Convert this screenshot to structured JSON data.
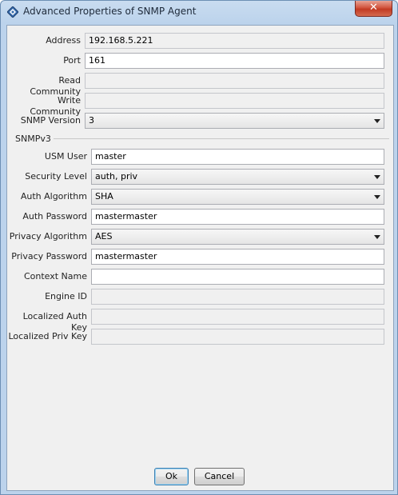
{
  "window": {
    "title": "Advanced Properties of SNMP Agent",
    "close_glyph": "✕"
  },
  "fields": {
    "address": {
      "label": "Address",
      "value": "192.168.5.221"
    },
    "port": {
      "label": "Port",
      "value": "161"
    },
    "read_community": {
      "label": "Read Community",
      "value": ""
    },
    "write_community": {
      "label": "Write Community",
      "value": ""
    },
    "snmp_version": {
      "label": "SNMP Version",
      "value": "3"
    }
  },
  "snmpv3": {
    "section_label": "SNMPv3",
    "usm_user": {
      "label": "USM User",
      "value": "master"
    },
    "security_level": {
      "label": "Security Level",
      "value": "auth, priv"
    },
    "auth_algorithm": {
      "label": "Auth Algorithm",
      "value": "SHA"
    },
    "auth_password": {
      "label": "Auth Password",
      "value": "mastermaster"
    },
    "privacy_algorithm": {
      "label": "Privacy Algorithm",
      "value": "AES"
    },
    "privacy_password": {
      "label": "Privacy Password",
      "value": "mastermaster"
    },
    "context_name": {
      "label": "Context Name",
      "value": ""
    },
    "engine_id": {
      "label": "Engine ID",
      "value": ""
    },
    "localized_auth_key": {
      "label": "Localized Auth Key",
      "value": ""
    },
    "localized_priv_key": {
      "label": "Localized Priv Key",
      "value": ""
    }
  },
  "buttons": {
    "ok": "Ok",
    "cancel": "Cancel"
  },
  "colors": {
    "title_bar": "#bcd3ec",
    "close_button": "#c23a23",
    "panel": "#f0f0f0"
  }
}
